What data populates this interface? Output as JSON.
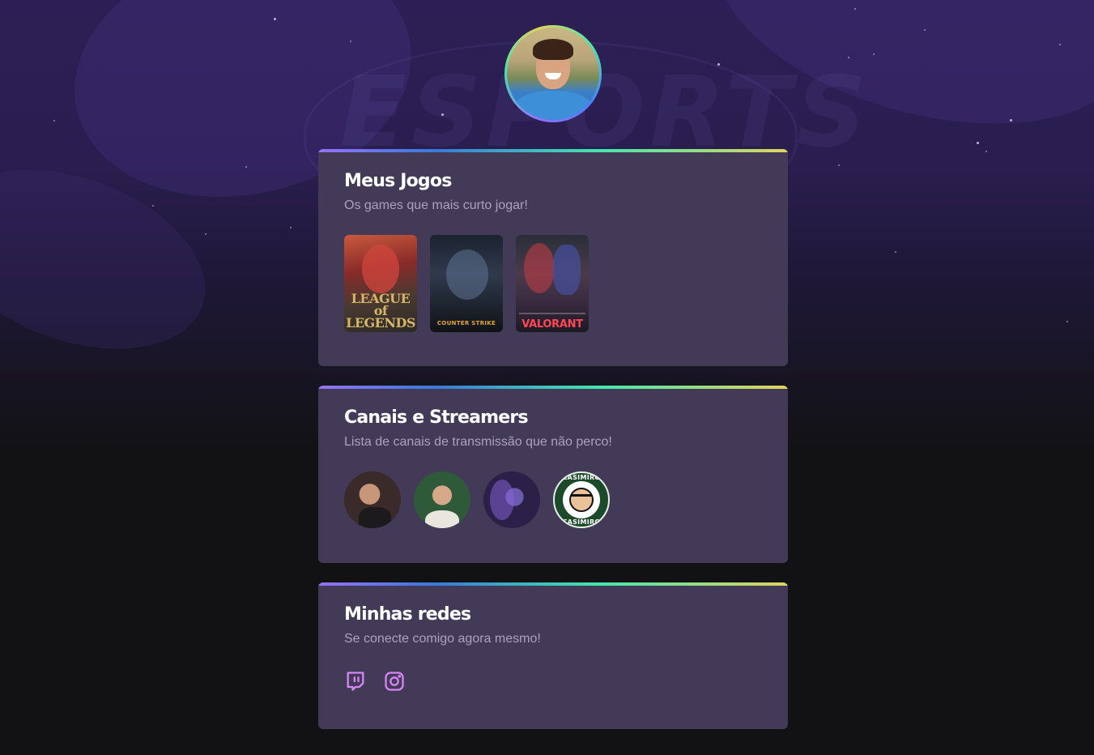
{
  "profile": {
    "avatar_alt": "Foto de perfil"
  },
  "cards": {
    "games": {
      "title": "Meus Jogos",
      "subtitle": "Os games que mais curto jogar!",
      "items": [
        {
          "name": "League of Legends",
          "label_line1": "LEAGUE of",
          "label_line2": "LEGENDS"
        },
        {
          "name": "Counter-Strike",
          "label": "COUNTER STRIKE"
        },
        {
          "name": "Valorant",
          "label": "VALORANT"
        }
      ]
    },
    "streamers": {
      "title": "Canais e Streamers",
      "subtitle": "Lista de canais de transmissão que não perco!",
      "items": [
        {
          "name": "streamer-1"
        },
        {
          "name": "streamer-2"
        },
        {
          "name": "streamer-3"
        },
        {
          "name": "Casimiro",
          "ring_top": "CASIMIRO",
          "ring_bottom": "CASIMIRO"
        }
      ]
    },
    "social": {
      "title": "Minhas redes",
      "subtitle": "Se conecte comigo agora mesmo!",
      "links": [
        {
          "name": "twitch",
          "icon": "twitch-icon"
        },
        {
          "name": "instagram",
          "icon": "instagram-icon"
        }
      ]
    }
  },
  "colors": {
    "background": "#121214",
    "card": "#423a57",
    "accent_gradient": [
      "#9572fc",
      "#43e7ad",
      "#e2d45c"
    ],
    "icon": "#d586f4"
  }
}
